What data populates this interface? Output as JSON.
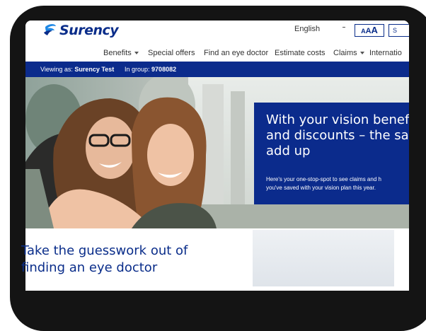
{
  "header": {
    "brand": "Surency",
    "language": "English",
    "text_size_button": [
      "A",
      "A",
      "A"
    ],
    "sign_in_fragment": "S"
  },
  "nav": {
    "items": [
      {
        "label": "Benefits",
        "has_dropdown": true
      },
      {
        "label": "Special offers",
        "has_dropdown": false
      },
      {
        "label": "Find an eye doctor",
        "has_dropdown": false
      },
      {
        "label": "Estimate costs",
        "has_dropdown": false
      },
      {
        "label": "Claims",
        "has_dropdown": true
      },
      {
        "label": "Internatio",
        "has_dropdown": false
      }
    ]
  },
  "context_bar": {
    "viewing_label": "Viewing as:",
    "viewing_value": "Surency Test",
    "group_label": "In group:",
    "group_value": "9708082"
  },
  "hero": {
    "title": "With your vision benef\nand discounts – the sa\nadd up",
    "description": "Here's your one-stop-spot to see claims and h\nyou've saved with your vision plan this year."
  },
  "section": {
    "title": "Take the guesswork out of\nfinding an eye doctor"
  },
  "colors": {
    "brand_blue": "#0b2b8c",
    "device_frame": "#141414"
  }
}
